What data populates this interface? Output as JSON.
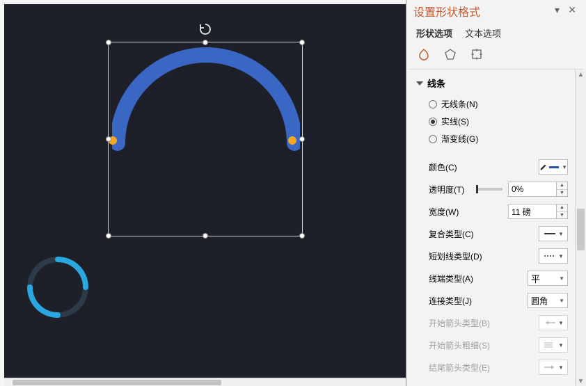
{
  "panel": {
    "title": "设置形状格式",
    "tabs": [
      {
        "label": "形状选项",
        "active": true
      },
      {
        "label": "文本选项",
        "active": false
      }
    ]
  },
  "section": {
    "line_title": "线条",
    "options": {
      "none": "无线条(N)",
      "solid": "实线(S)",
      "gradient": "渐变线(G)",
      "selected": "solid"
    },
    "props": {
      "color_label": "颜色(C)",
      "transparency_label": "透明度(T)",
      "transparency_value": "0%",
      "width_label": "宽度(W)",
      "width_value": "11 磅",
      "compound_label": "复合类型(C)",
      "dash_label": "短划线类型(D)",
      "cap_label": "线端类型(A)",
      "cap_value": "平",
      "join_label": "连接类型(J)",
      "join_value": "圆角",
      "arrow_begin_type": "开始箭头类型(B)",
      "arrow_begin_size": "开始箭头粗细(S)",
      "arrow_end_type": "结尾箭头类型(E)"
    }
  },
  "colors": {
    "arc": "#3a66c4",
    "spinner": "#29a7df"
  }
}
